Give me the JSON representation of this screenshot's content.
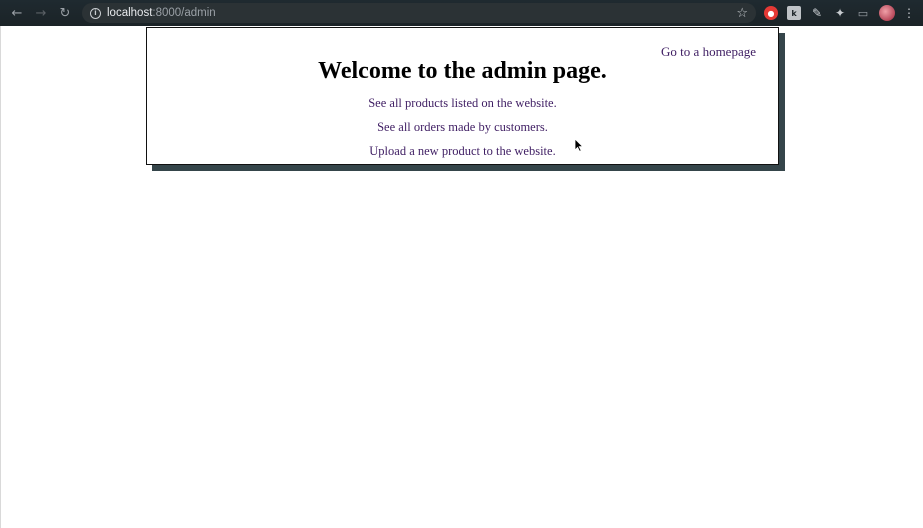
{
  "browser": {
    "url_host": "localhost",
    "url_rest": ":8000/admin",
    "extensions": {
      "gray_label": "k"
    }
  },
  "admin": {
    "home_link": "Go to a homepage",
    "title": "Welcome to the admin page.",
    "links": [
      "See all products listed on the website.",
      "See all orders made by customers.",
      "Upload a new product to the website."
    ],
    "link_color": "#3f1e63",
    "shadow_color": "#35454a"
  },
  "icons": [
    "back-icon",
    "forward-icon",
    "reload-icon",
    "info-icon",
    "star-icon",
    "puzzle-icon",
    "cast-icon",
    "menu-icon"
  ]
}
